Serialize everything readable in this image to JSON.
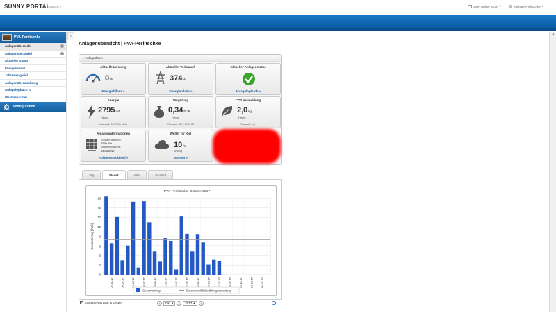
{
  "header": {
    "logo": "SUNNY PORTAL",
    "language": "Deutsch",
    "store": "SMA Online Store",
    "user": "Michael Perlitschke"
  },
  "sidebar": {
    "plant": "PVA-Perlitschke",
    "items": [
      {
        "label": "Anlagenübersicht",
        "active": true
      },
      {
        "label": "Anlagensteckbrief",
        "active": false
      },
      {
        "label": "Aktueller Status",
        "active": false
      },
      {
        "label": "Energiebilanz",
        "active": false
      },
      {
        "label": "Jahresvergleich",
        "active": false
      },
      {
        "label": "Anlagenüberwachung",
        "active": false
      },
      {
        "label": "Anlagelogbuch: 0",
        "active": false
      },
      {
        "label": "Wechselrichter",
        "active": false
      }
    ],
    "config": "Konfiguration"
  },
  "page": {
    "title": "Anlagenübersicht | PVA-Perlitschke"
  },
  "panel": {
    "title": "Anlagedaten",
    "tiles": {
      "leistung": {
        "title": "Aktuelle Leistung",
        "value": "0",
        "unit": "W",
        "link": "Energiebilanz »"
      },
      "verbrauch": {
        "title": "Aktueller Verbrauch",
        "value": "374",
        "unit": "W",
        "link": "Energiebilanz »"
      },
      "status": {
        "title": "Aktueller Anlagenstatus",
        "link": "Anlagelogbuch »"
      },
      "energie": {
        "title": "Energie",
        "value": "2795",
        "unit": "Wh",
        "sub": "Heute",
        "total": "Gesamt: 1901,59 kWh"
      },
      "verguetung": {
        "title": "Vergütung",
        "value": "0,34",
        "unit": "EUR",
        "sub": "Heute",
        "total": "Gesamt: 357,14 EUR"
      },
      "co2": {
        "title": "CO2 Vermeidung",
        "value": "2,0",
        "unit": "kg",
        "sub": "Heute",
        "total": "Gesamt: 2,0 t"
      },
      "info": {
        "title": "Anlageninformationen",
        "l1": "Anlagenleistung:",
        "l2": "4200 Wp",
        "l3": "Inbetriebnahme:",
        "l4": "03.04.2017",
        "link": "Anlagensteckbrief »"
      },
      "wetter": {
        "title": "Wetter für Kiel",
        "value": "10",
        "unit": "°C",
        "sub": "Wolkig",
        "link": "Morgen »"
      }
    }
  },
  "tabs": [
    "Tag",
    "Monat",
    "Jahr",
    "Gesamt"
  ],
  "active_tab": "Monat",
  "chart_data": {
    "type": "bar",
    "title": "PVA-Perlitschke: Oktober 2017",
    "ylabel": "Gesamtertrag [kWh]",
    "ylim": [
      0,
      16
    ],
    "yticks": [
      0,
      2,
      4,
      6,
      8,
      10,
      12,
      14,
      16
    ],
    "categories": [
      "01.10.17",
      "02.10.17",
      "03.10.17",
      "04.10.17",
      "05.10.17",
      "06.10.17",
      "07.10.17",
      "08.10.17",
      "09.10.17",
      "10.10.17",
      "11.10.17",
      "12.10.17",
      "13.10.17",
      "14.10.17",
      "15.10.17",
      "16.10.17",
      "17.10.17",
      "18.10.17",
      "19.10.17",
      "20.10.17",
      "21.10.17",
      "22.10.17",
      "23.10.17",
      "24.10.17",
      "25.10.17",
      "26.10.17",
      "27.10.17",
      "28.10.17",
      "29.10.17",
      "30.10.17",
      "31.10.17"
    ],
    "xtick_labels": [
      "02.10.17",
      "04.10.17",
      "06.10.17",
      "08.10.17",
      "10.10.17",
      "12.10.17",
      "14.10.17",
      "16.10.17",
      "18.10.17",
      "20.10.17",
      "22.10.17",
      "24.10.17",
      "26.10.17",
      "28.10.17",
      "30.10.17"
    ],
    "series": [
      {
        "name": "Gesamtertrag",
        "values": [
          16.4,
          6.5,
          12.1,
          3.0,
          6.0,
          15.3,
          1.5,
          15.4,
          11.0,
          4.9,
          2.7,
          7.7,
          7.1,
          1.1,
          12.2,
          8.6,
          4.9,
          8.4,
          6.8,
          2.1,
          3.1,
          2.9,
          0,
          0,
          0,
          0,
          0,
          0,
          0,
          0,
          0
        ],
        "color": "#2458c4"
      },
      {
        "name": "Durchschnittliche Ertragserwartung",
        "value": 7.4,
        "color": "#999999"
      }
    ],
    "legend": "bottom"
  },
  "controls": {
    "checkbox": "Ertragserwartung anzeigen *",
    "month": "Okt",
    "year": "2017"
  }
}
